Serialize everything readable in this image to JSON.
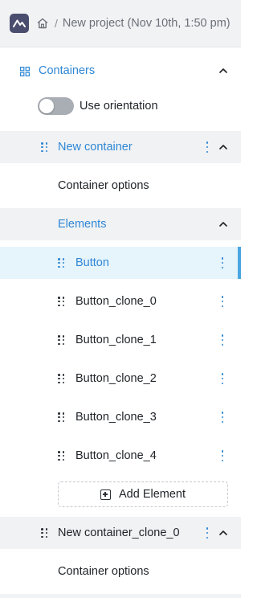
{
  "header": {
    "breadcrumb_separator": "/",
    "project_title": "New project (Nov 10th, 1:50 pm)"
  },
  "containers_section": {
    "title": "Containers",
    "toggle_label": "Use orientation",
    "toggle_on": false
  },
  "container_1": {
    "title": "New container",
    "options_label": "Container options",
    "elements_title": "Elements",
    "elements": [
      {
        "label": "Button"
      },
      {
        "label": "Button_clone_0"
      },
      {
        "label": "Button_clone_1"
      },
      {
        "label": "Button_clone_2"
      },
      {
        "label": "Button_clone_3"
      },
      {
        "label": "Button_clone_4"
      }
    ],
    "add_element_label": "Add Element"
  },
  "container_2": {
    "title": "New container_clone_0",
    "options_label": "Container options"
  },
  "colors": {
    "accent": "#2f87d4",
    "header_bg": "#f1f2f4",
    "selected_bg": "#e6f4fc",
    "logo_bg": "#4b4d6e"
  },
  "icons": [
    "logo-icon",
    "home-icon",
    "grid-icon",
    "chevron-up-icon",
    "drag-handle-icon",
    "kebab-menu-icon",
    "plus-square-icon"
  ]
}
